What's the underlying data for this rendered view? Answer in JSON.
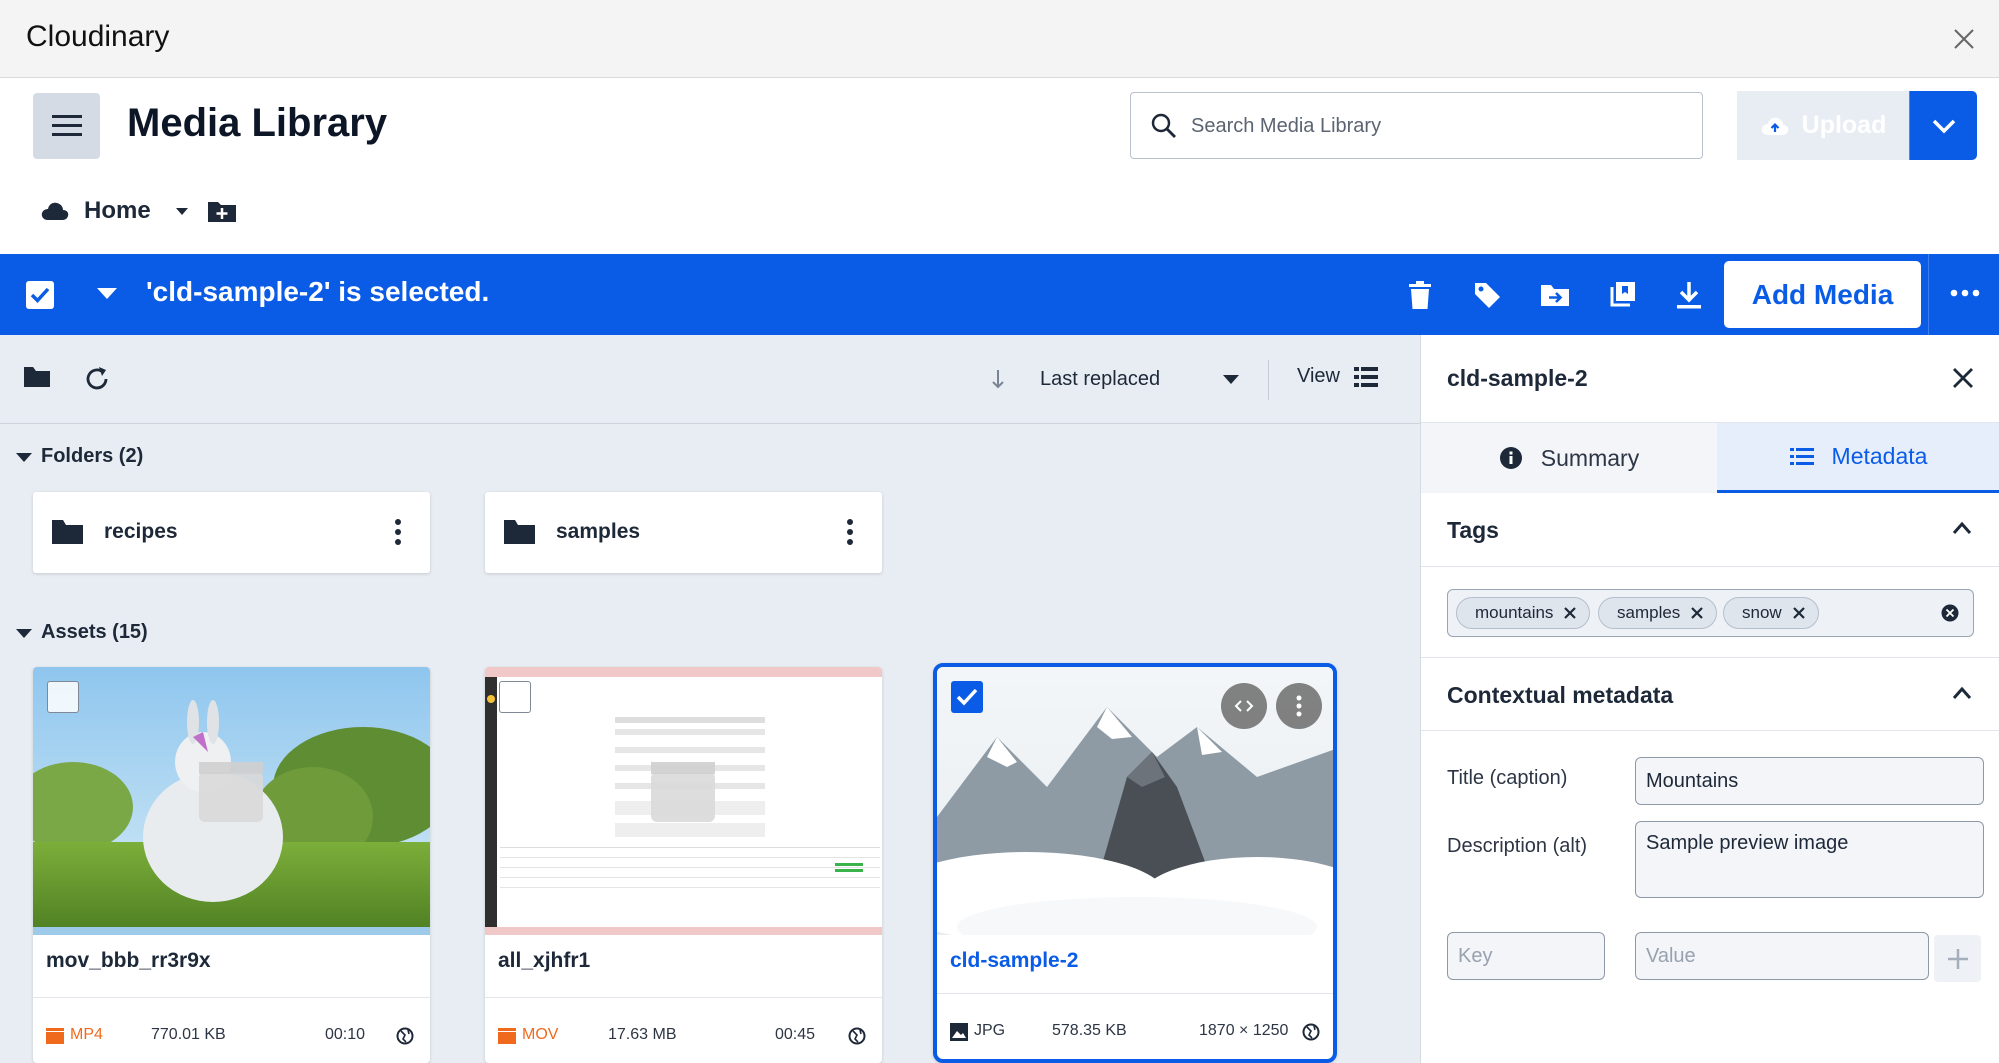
{
  "window": {
    "title": "Cloudinary"
  },
  "header": {
    "page_title": "Media Library",
    "search_placeholder": "Search Media Library",
    "upload_label": "Upload",
    "breadcrumb_home": "Home"
  },
  "selection_bar": {
    "text": "'cld-sample-2' is selected.",
    "add_media_label": "Add Media",
    "actions": [
      "trash-icon",
      "tag-icon",
      "move-icon",
      "collection-icon",
      "download-icon"
    ]
  },
  "toolbar": {
    "sort_label": "Last replaced",
    "view_label": "View"
  },
  "folders": {
    "header": "Folders (2)",
    "items": [
      {
        "name": "recipes"
      },
      {
        "name": "samples"
      }
    ]
  },
  "assets": {
    "header": "Assets (15)",
    "items": [
      {
        "name": "mov_bbb_rr3r9x",
        "format": "MP4",
        "size": "770.01 KB",
        "detail": "00:10",
        "selected": false
      },
      {
        "name": "all_xjhfr1",
        "format": "MOV",
        "size": "17.63 MB",
        "detail": "00:45",
        "selected": false
      },
      {
        "name": "cld-sample-2",
        "format": "JPG",
        "size": "578.35 KB",
        "detail": "1870 × 1250",
        "selected": true
      }
    ]
  },
  "details_panel": {
    "title": "cld-sample-2",
    "tabs": [
      "Summary",
      "Metadata"
    ],
    "active_tab": "Metadata",
    "tags_section": "Tags",
    "tags": [
      "mountains",
      "samples",
      "snow"
    ],
    "contextual_section": "Contextual metadata",
    "fields": {
      "title_label": "Title (caption)",
      "title_value": "Mountains",
      "description_label": "Description (alt)",
      "description_value": "Sample preview image",
      "key_placeholder": "Key",
      "value_placeholder": "Value"
    }
  },
  "colors": {
    "accent": "#0a5ce6",
    "video_badge": "#f06a1d",
    "panel_bg": "#e8edf3"
  }
}
